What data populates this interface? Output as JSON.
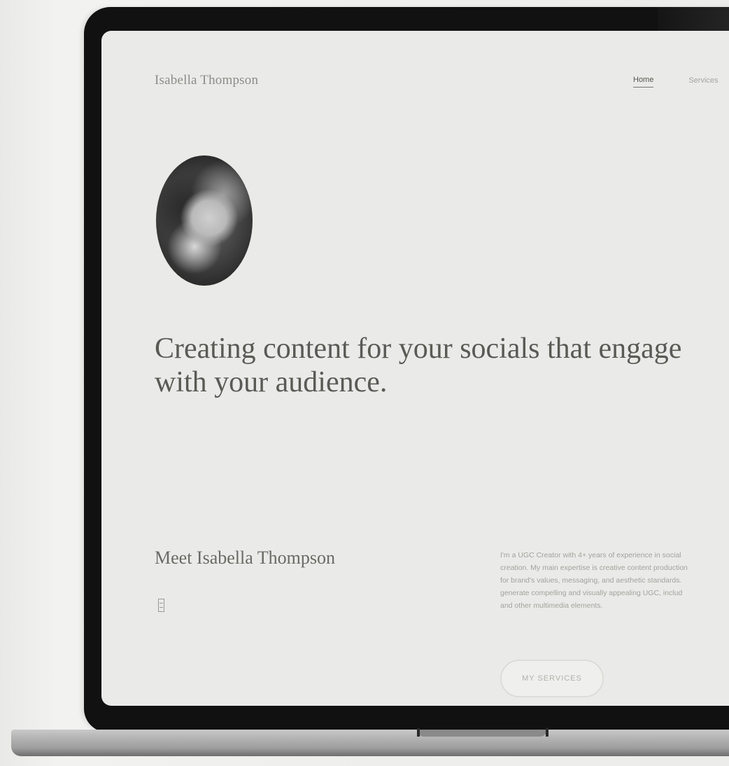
{
  "site": {
    "brand": "Isabella Thompson",
    "nav": [
      {
        "label": "Home",
        "active": true
      },
      {
        "label": "Services",
        "active": false
      }
    ],
    "hero": {
      "title": "Creating content for your socials that engage with your audience."
    },
    "about": {
      "heading": "Meet Isabella Thompson",
      "bio_lines": [
        "I'm a UGC Creator with 4+ years of experience in social",
        "creation. My main expertise is creative content production",
        "for brand's values, messaging, and aesthetic standards.",
        "generate compelling and visually appealing UGC, includ",
        "and other multimedia elements."
      ],
      "more_button": "MY SERVICES"
    }
  },
  "colors": {
    "screen_bg": "#eaeae8",
    "heading_text": "#5a5a55",
    "bezel": "#111111"
  },
  "icons": {
    "meet_icon": "menu-icon"
  }
}
